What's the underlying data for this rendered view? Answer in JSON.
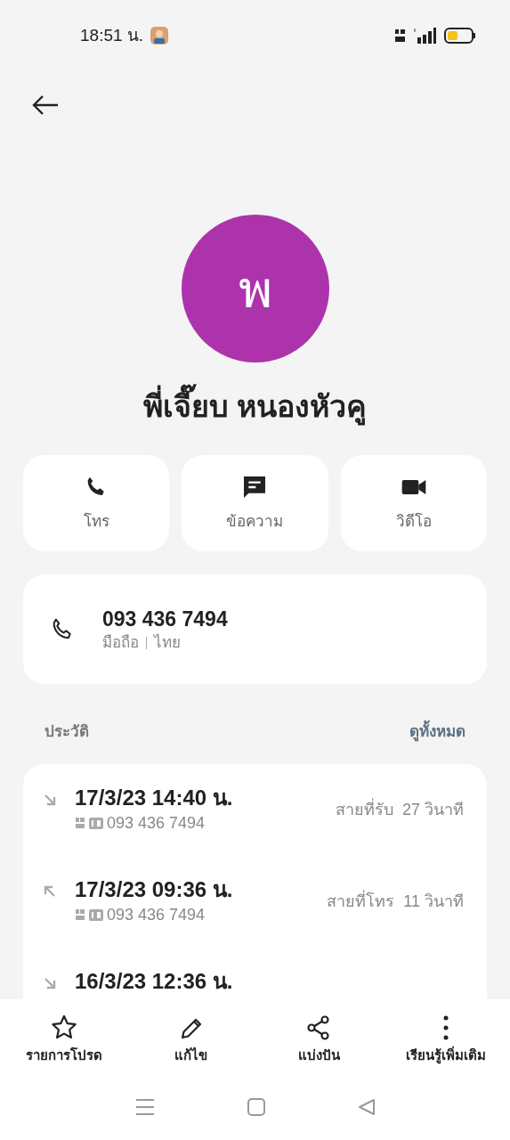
{
  "status_bar": {
    "time": "18:51 น."
  },
  "contact": {
    "initial": "พ",
    "name": "พี่เจี๊ยบ หนองหัวคู"
  },
  "actions": [
    {
      "kind": "call",
      "label": "โทร"
    },
    {
      "kind": "message",
      "label": "ข้อความ"
    },
    {
      "kind": "video",
      "label": "วิดีโอ"
    }
  ],
  "phone": {
    "number": "093 436 7494",
    "type": "มือถือ",
    "region": "ไทย"
  },
  "history": {
    "title": "ประวัติ",
    "see_all": "ดูทั้งหมด",
    "calls": [
      {
        "kind": "incoming",
        "datetime": "17/3/23 14:40 น.",
        "number": "093 436 7494",
        "type": "สายที่รับ",
        "duration": "27 วินาที"
      },
      {
        "kind": "outgoing",
        "datetime": "17/3/23 09:36 น.",
        "number": "093 436 7494",
        "type": "สายที่โทร",
        "duration": "11 วินาที"
      },
      {
        "kind": "incoming",
        "datetime": "16/3/23 12:36 น."
      }
    ]
  },
  "bottom_actions": [
    {
      "kind": "star",
      "label": "รายการโปรด"
    },
    {
      "kind": "edit",
      "label": "แก้ไข"
    },
    {
      "kind": "share",
      "label": "แบ่งปัน"
    },
    {
      "kind": "more",
      "label": "เรียนรู้เพิ่มเติม"
    }
  ]
}
